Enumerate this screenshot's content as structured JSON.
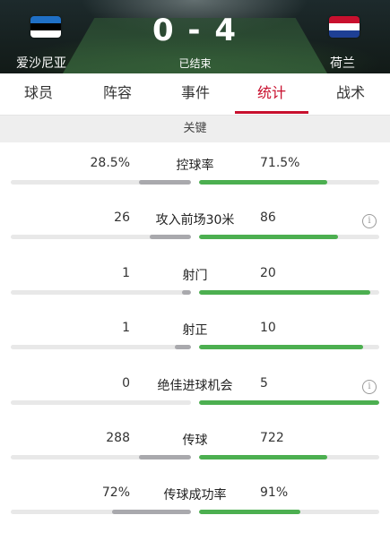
{
  "header": {
    "home_team": "爱沙尼亚",
    "away_team": "荷兰",
    "score": "0 - 4",
    "status": "已结束",
    "home_flag_colors": [
      "#1f6fc5",
      "#000000",
      "#ffffff"
    ],
    "away_flag_colors": [
      "#c8102e",
      "#ffffff",
      "#1e3f94"
    ]
  },
  "tabs": [
    {
      "label": "球员"
    },
    {
      "label": "阵容"
    },
    {
      "label": "事件"
    },
    {
      "label": "统计"
    },
    {
      "label": "战术"
    }
  ],
  "active_tab": "统计",
  "section": {
    "title": "关键"
  },
  "stats": [
    {
      "label": "控球率",
      "home": "28.5%",
      "away": "71.5%",
      "home_fill": 0.29,
      "away_fill": 0.71,
      "info": false
    },
    {
      "label": "攻入前场30米",
      "home": "26",
      "away": "86",
      "home_fill": 0.23,
      "away_fill": 0.77,
      "info": true
    },
    {
      "label": "射门",
      "home": "1",
      "away": "20",
      "home_fill": 0.05,
      "away_fill": 0.95,
      "info": false
    },
    {
      "label": "射正",
      "home": "1",
      "away": "10",
      "home_fill": 0.09,
      "away_fill": 0.91,
      "info": false
    },
    {
      "label": "绝佳进球机会",
      "home": "0",
      "away": "5",
      "home_fill": 0.0,
      "away_fill": 1.0,
      "info": true
    },
    {
      "label": "传球",
      "home": "288",
      "away": "722",
      "home_fill": 0.29,
      "away_fill": 0.71,
      "info": false
    },
    {
      "label": "传球成功率",
      "home": "72%",
      "away": "91%",
      "home_fill": 0.44,
      "away_fill": 0.56,
      "info": false
    }
  ],
  "colors": {
    "accent": "#c8102e",
    "away_bar": "#4caf50",
    "home_bar": "#a9a9ad"
  }
}
